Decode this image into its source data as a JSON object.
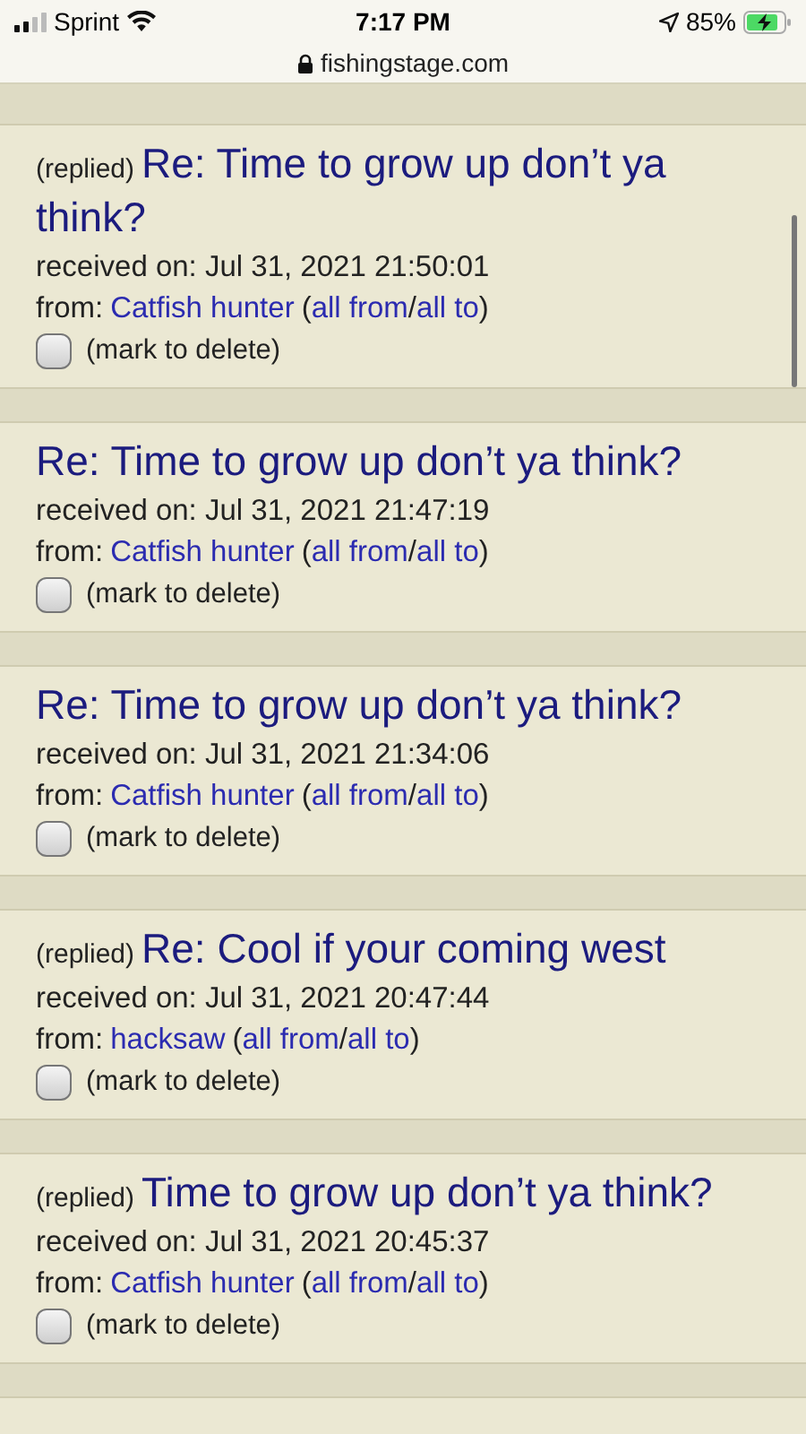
{
  "status_bar": {
    "carrier": "Sprint",
    "time": "7:17 PM",
    "battery": "85%"
  },
  "address_bar": {
    "url": "fishingstage.com"
  },
  "messages": [
    {
      "tag": "(replied)",
      "title": "Re: Time to grow up don’t ya think?",
      "received": "received on: Jul 31, 2021 21:50:01",
      "from_label": "from:",
      "sender": "Catfish hunter",
      "open": "(",
      "all_from": "all from",
      "separator": "/",
      "all_to": "all to",
      "close": ")",
      "checked": false,
      "mark_label": "(mark to delete)"
    },
    {
      "title": "Re: Time to grow up don’t ya think?",
      "received": "received on: Jul 31, 2021 21:47:19",
      "from_label": "from:",
      "sender": "Catfish hunter",
      "open": "(",
      "all_from": "all from",
      "separator": "/",
      "all_to": "all to",
      "close": ")",
      "checked": false,
      "mark_label": "(mark to delete)"
    },
    {
      "title": "Re: Time to grow up don’t ya think?",
      "received": "received on: Jul 31, 2021 21:34:06",
      "from_label": "from:",
      "sender": "Catfish hunter",
      "open": "(",
      "all_from": "all from",
      "separator": "/",
      "all_to": "all to",
      "close": ")",
      "checked": false,
      "mark_label": "(mark to delete)"
    },
    {
      "tag": "(replied)",
      "title": "Re: Cool if your coming west",
      "received": "received on: Jul 31, 2021 20:47:44",
      "from_label": "from:",
      "sender": "hacksaw",
      "open": "(",
      "all_from": "all from",
      "separator": "/",
      "all_to": "all to",
      "close": ")",
      "checked": false,
      "mark_label": "(mark to delete)"
    },
    {
      "tag": "(replied)",
      "title": "Time to grow up don’t ya think?",
      "received": "received on: Jul 31, 2021 20:45:37",
      "from_label": "from:",
      "sender": "Catfish hunter",
      "open": "(",
      "all_from": "all from",
      "separator": "/",
      "all_to": "all to",
      "close": ")",
      "checked": false,
      "mark_label": "(mark to delete)"
    }
  ]
}
